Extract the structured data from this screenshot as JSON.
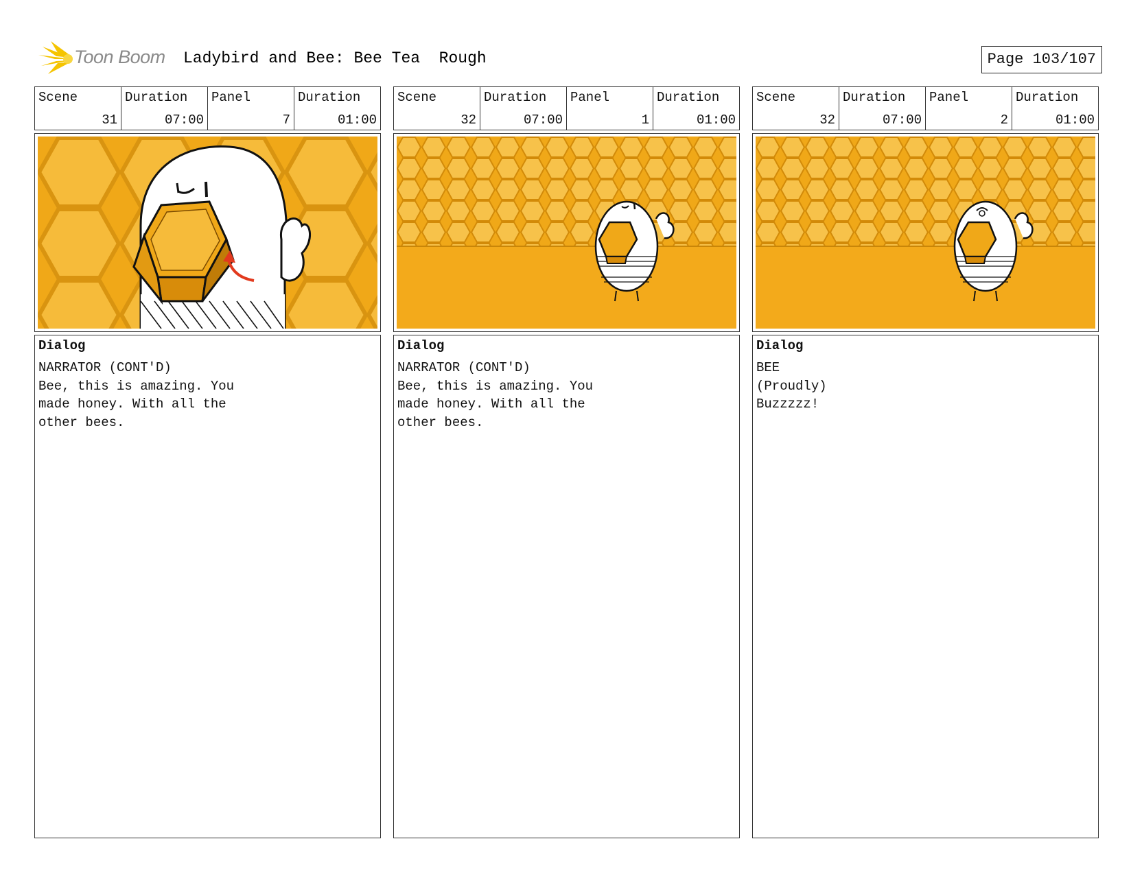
{
  "header": {
    "logo_text": "Toon Boom",
    "title": "Ladybird and Bee: Bee Tea  Rough",
    "page": "Page 103/107"
  },
  "labels": {
    "scene": "Scene",
    "duration": "Duration",
    "panel": "Panel",
    "dialog": "Dialog"
  },
  "panels": [
    {
      "scene": "31",
      "scene_duration": "07:00",
      "panel": "7",
      "panel_duration": "01:00",
      "dialog_lines": [
        "NARRATOR (CONT'D)",
        "Bee, this is amazing. You",
        "made honey. With all the",
        "other bees."
      ]
    },
    {
      "scene": "32",
      "scene_duration": "07:00",
      "panel": "1",
      "panel_duration": "01:00",
      "dialog_lines": [
        "NARRATOR (CONT'D)",
        "Bee, this is amazing. You",
        "made honey. With all the",
        "other bees."
      ]
    },
    {
      "scene": "32",
      "scene_duration": "07:00",
      "panel": "2",
      "panel_duration": "01:00",
      "dialog_lines": [
        "BEE",
        "(Proudly)",
        "Buzzzzz!"
      ]
    }
  ],
  "colors": {
    "honey": "#f0a818",
    "honey_light": "#f7c24a",
    "honey_dark": "#d88c0a",
    "logo_star": "#f5c400",
    "arrow": "#e23a1e"
  }
}
